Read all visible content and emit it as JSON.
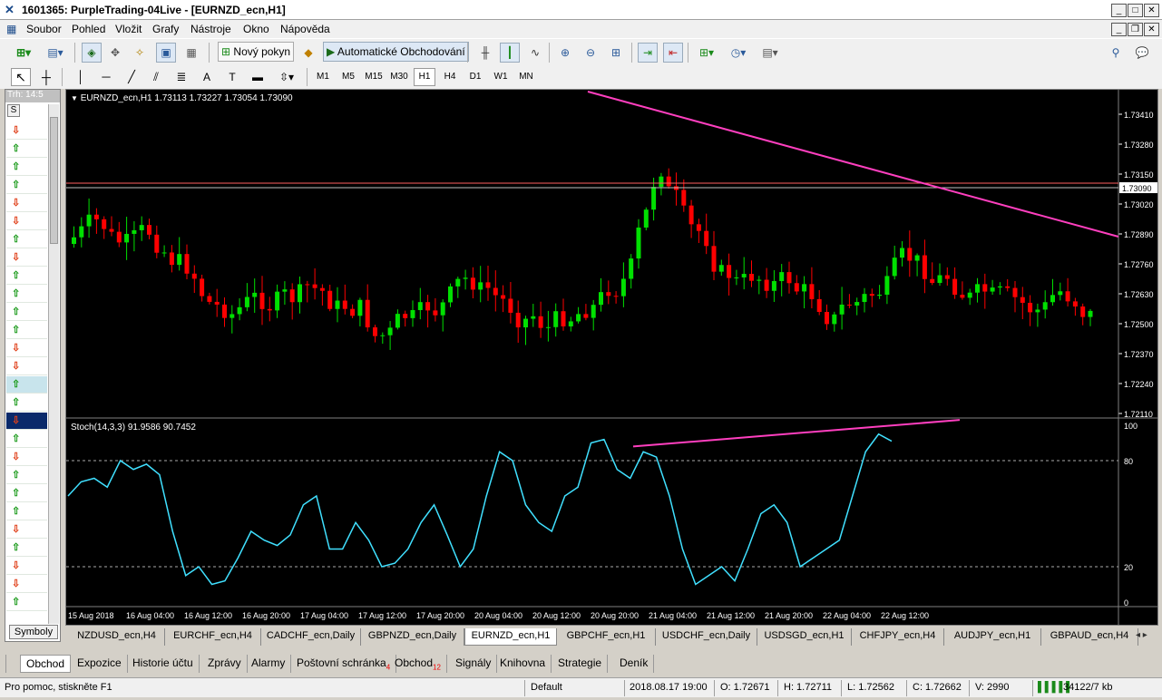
{
  "window": {
    "title": "1601365: PurpleTrading-04Live - [EURNZD_ecn,H1]",
    "controls": [
      "_",
      "□",
      "✕"
    ],
    "child_controls": [
      "_",
      "❐",
      "✕"
    ]
  },
  "menu": [
    "Soubor",
    "Pohled",
    "Vložit",
    "Grafy",
    "Nástroje",
    "Okno",
    "Nápověda"
  ],
  "toolbar": {
    "new_order_label": "Nový pokyn",
    "auto_trading_label": "Automatické Obchodování"
  },
  "timeframes": [
    "M1",
    "M5",
    "M15",
    "M30",
    "H1",
    "H4",
    "D1",
    "W1",
    "MN"
  ],
  "active_timeframe": "H1",
  "market_watch": {
    "header": "Trh: 14:5",
    "column": "S",
    "button": "Symboly",
    "rows": [
      "dn",
      "up",
      "up",
      "up",
      "dn",
      "dn",
      "up",
      "dn",
      "up",
      "up",
      "up",
      "up",
      "dn",
      "dn",
      "up",
      "up",
      "dn",
      "up",
      "dn",
      "up",
      "up",
      "up",
      "dn",
      "up",
      "dn",
      "dn",
      "up",
      "dn",
      "up",
      "up",
      "dn",
      "up",
      "dn",
      "dn",
      "up",
      "dn",
      "up"
    ]
  },
  "chart": {
    "header": "EURNZD_ecn,H1  1.73113 1.73227 1.73054 1.73090",
    "indicator_header": "Stoch(14,3,3) 91.9586 90.7452",
    "price_labels": [
      "1.73410",
      "1.73280",
      "1.73150",
      "1.73020",
      "1.72890",
      "1.72760",
      "1.72630",
      "1.72500",
      "1.72370",
      "1.72240",
      "1.72110"
    ],
    "current_price": "1.73090",
    "stoch_labels": [
      "100",
      "80",
      "20",
      "0"
    ],
    "time_labels": [
      "15 Aug 2018",
      "16 Aug 04:00",
      "16 Aug 12:00",
      "16 Aug 20:00",
      "17 Aug 04:00",
      "17 Aug 12:00",
      "17 Aug 20:00",
      "20 Aug 04:00",
      "20 Aug 12:00",
      "20 Aug 20:00",
      "21 Aug 04:00",
      "21 Aug 12:00",
      "21 Aug 20:00",
      "22 Aug 04:00",
      "22 Aug 12:00"
    ],
    "colors": {
      "bull": "#00e000",
      "bear": "#ff0000",
      "trend": "#ff3fbf",
      "stoch": "#40e0ff",
      "hline": "#ff6060"
    }
  },
  "chart_tabs": [
    "NZDUSD_ecn,H4",
    "EURCHF_ecn,H4",
    "CADCHF_ecn,Daily",
    "GBPNZD_ecn,Daily",
    "EURNZD_ecn,H1",
    "GBPCHF_ecn,H1",
    "USDCHF_ecn,Daily",
    "USDSGD_ecn,H1",
    "CHFJPY_ecn,H4",
    "AUDJPY_ecn,H1",
    "GBPAUD_ecn,H4"
  ],
  "active_chart_tab": "EURNZD_ecn,H1",
  "terminal_tabs": [
    {
      "label": "Obchod",
      "badge": ""
    },
    {
      "label": "Expozice",
      "badge": ""
    },
    {
      "label": "Historie účtu",
      "badge": ""
    },
    {
      "label": "Zprávy",
      "badge": ""
    },
    {
      "label": "Alarmy",
      "badge": ""
    },
    {
      "label": "Poštovní schránka",
      "badge": "4"
    },
    {
      "label": "Obchod",
      "badge": "12"
    },
    {
      "label": "Signály",
      "badge": ""
    },
    {
      "label": "Knihovna",
      "badge": ""
    },
    {
      "label": "Strategie",
      "badge": ""
    },
    {
      "label": "Deník",
      "badge": ""
    }
  ],
  "status": {
    "help": "Pro pomoc, stiskněte F1",
    "profile": "Default",
    "datetime": "2018.08.17 19:00",
    "open": "O: 1.72671",
    "high": "H: 1.72711",
    "low": "L: 1.72562",
    "close": "C: 1.72662",
    "volume": "V: 2990",
    "traffic": "34122/7 kb"
  }
}
